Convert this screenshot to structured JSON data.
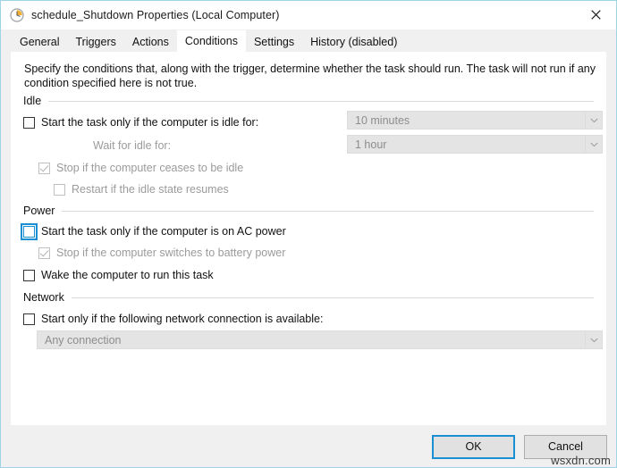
{
  "window": {
    "title": "schedule_Shutdown Properties (Local Computer)",
    "title_icon": "clock-icon",
    "close_icon": "close-icon",
    "border_color": "#9fd3e8"
  },
  "tabs": [
    {
      "label": "General",
      "active": false
    },
    {
      "label": "Triggers",
      "active": false
    },
    {
      "label": "Actions",
      "active": false
    },
    {
      "label": "Conditions",
      "active": true
    },
    {
      "label": "Settings",
      "active": false
    },
    {
      "label": "History (disabled)",
      "active": false
    }
  ],
  "content": {
    "description": "Specify the conditions that, along with the trigger, determine whether the task should run.  The task will not run  if any condition specified here is not true.",
    "groups": {
      "idle": {
        "label": "Idle",
        "start_idle": {
          "label": "Start the task only if the computer is idle for:",
          "checked": false,
          "disabled": false
        },
        "idle_duration": {
          "value": "10 minutes",
          "disabled": true,
          "arrow_icon": "chevron-down-icon"
        },
        "wait_label": "Wait for idle for:",
        "wait_duration": {
          "value": "1 hour",
          "disabled": true,
          "arrow_icon": "chevron-down-icon"
        },
        "stop_ceases": {
          "label": "Stop if the computer ceases to be idle",
          "checked": true,
          "disabled": true
        },
        "restart_resumes": {
          "label": "Restart if the idle state resumes",
          "checked": false,
          "disabled": true
        }
      },
      "power": {
        "label": "Power",
        "ac_power": {
          "label": "Start the task only if the computer is on AC power",
          "checked": false,
          "disabled": false,
          "focused": true
        },
        "battery_stop": {
          "label": "Stop if the computer switches to battery power",
          "checked": true,
          "disabled": true
        },
        "wake_computer": {
          "label": "Wake the computer to run this task",
          "checked": false,
          "disabled": false
        }
      },
      "network": {
        "label": "Network",
        "start_network": {
          "label": "Start only if the following network connection is available:",
          "checked": false,
          "disabled": false
        },
        "connection": {
          "value": "Any connection",
          "disabled": true,
          "arrow_icon": "chevron-down-icon"
        }
      }
    }
  },
  "footer": {
    "ok_label": "OK",
    "cancel_label": "Cancel",
    "accent_color": "#1a8fd4"
  },
  "watermark": "wsxdn.com"
}
